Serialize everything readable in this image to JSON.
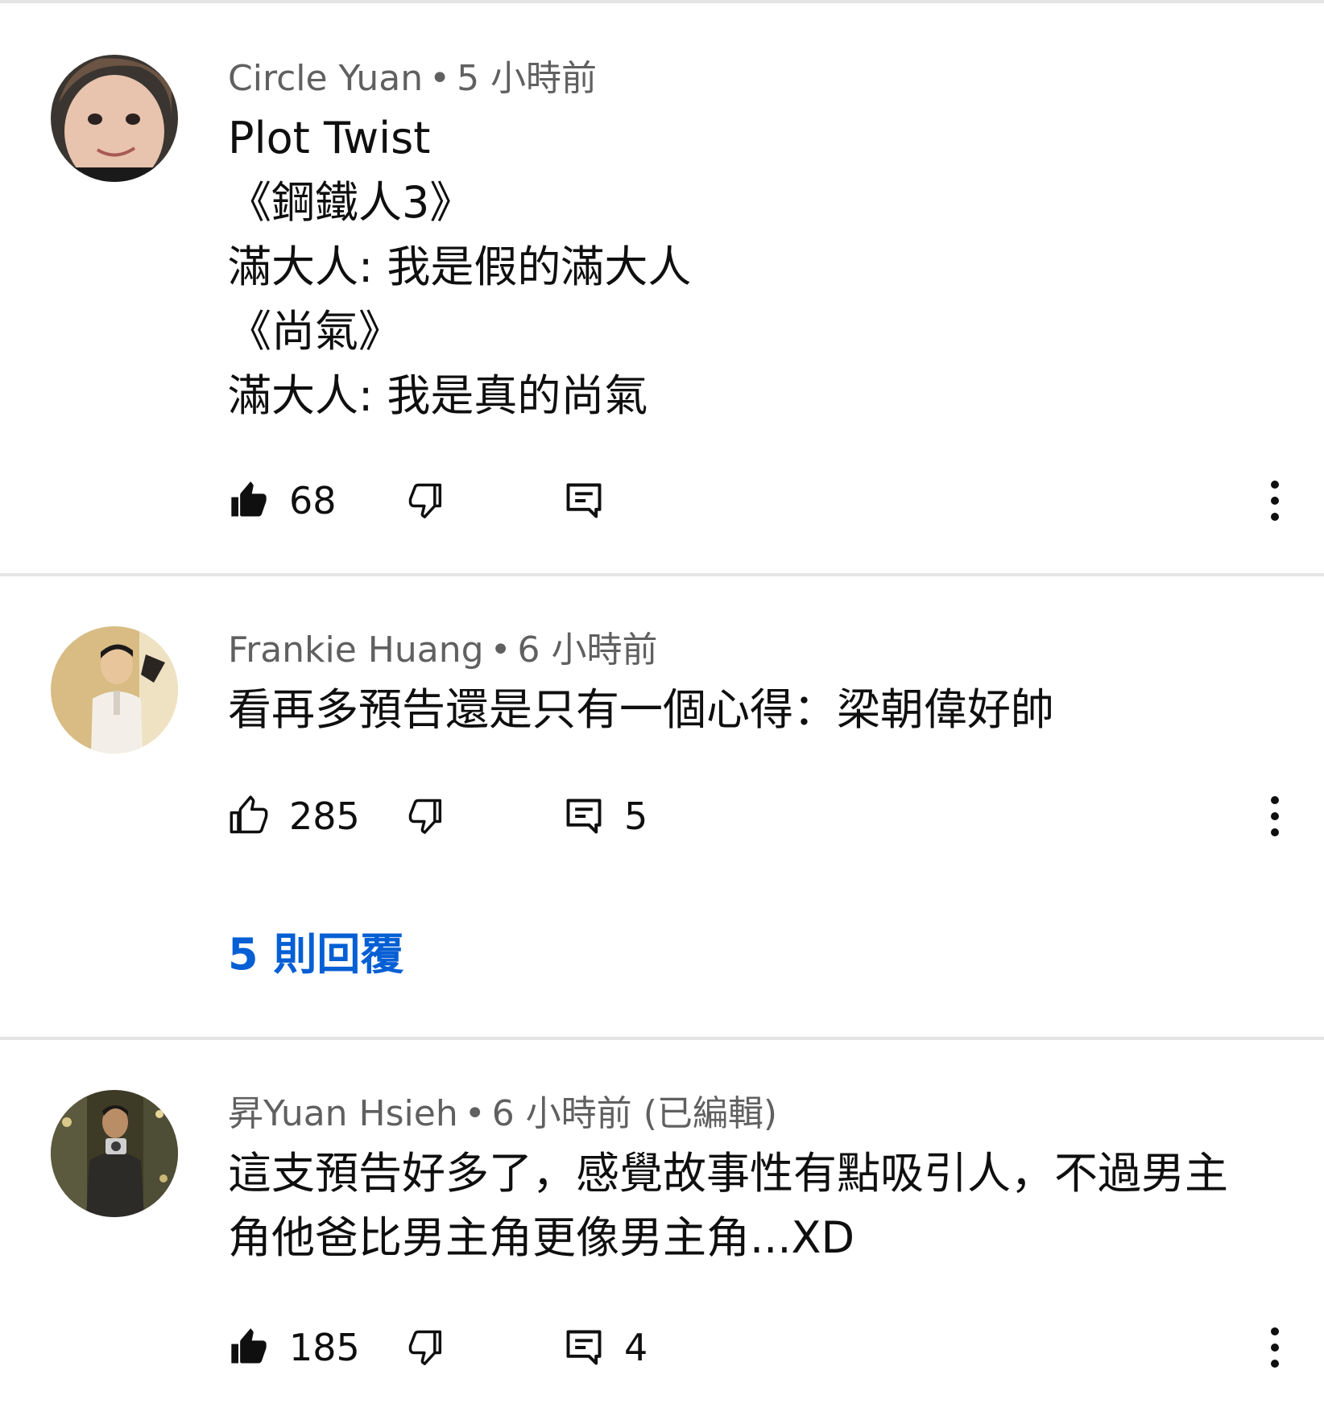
{
  "colors": {
    "meta_text": "#606060",
    "body_text": "#0f0f0f",
    "link": "#065fd4",
    "divider": "#e5e5e5"
  },
  "comments": [
    {
      "author": "Circle Yuan",
      "separator": "•",
      "time": "5 小時前",
      "edited": "",
      "lines": [
        "Plot Twist",
        "《鋼鐵人3》",
        "滿大人: 我是假的滿大人",
        "《尚氣》",
        "滿大人: 我是真的尚氣"
      ],
      "likes": "68",
      "liked": true,
      "replies_count": "",
      "avatar_icon": "avatar-child-icon"
    },
    {
      "author": "Frankie Huang",
      "separator": "•",
      "time": "6 小時前",
      "edited": "",
      "lines": [
        "看再多預告還是只有一個心得：梁朝偉好帥"
      ],
      "likes": "285",
      "liked": false,
      "replies_count": "5",
      "replies_link": "5 則回覆",
      "avatar_icon": "avatar-man-icon"
    },
    {
      "author": "昇Yuan Hsieh",
      "separator": "•",
      "time": "6 小時前",
      "edited": "(已編輯)",
      "lines": [
        "這支預告好多了，感覺故事性有點吸引人，不過男主",
        "角他爸比男主角更像男主角...XD"
      ],
      "likes": "185",
      "liked": true,
      "replies_count": "4",
      "avatar_icon": "avatar-selfie-icon"
    }
  ]
}
